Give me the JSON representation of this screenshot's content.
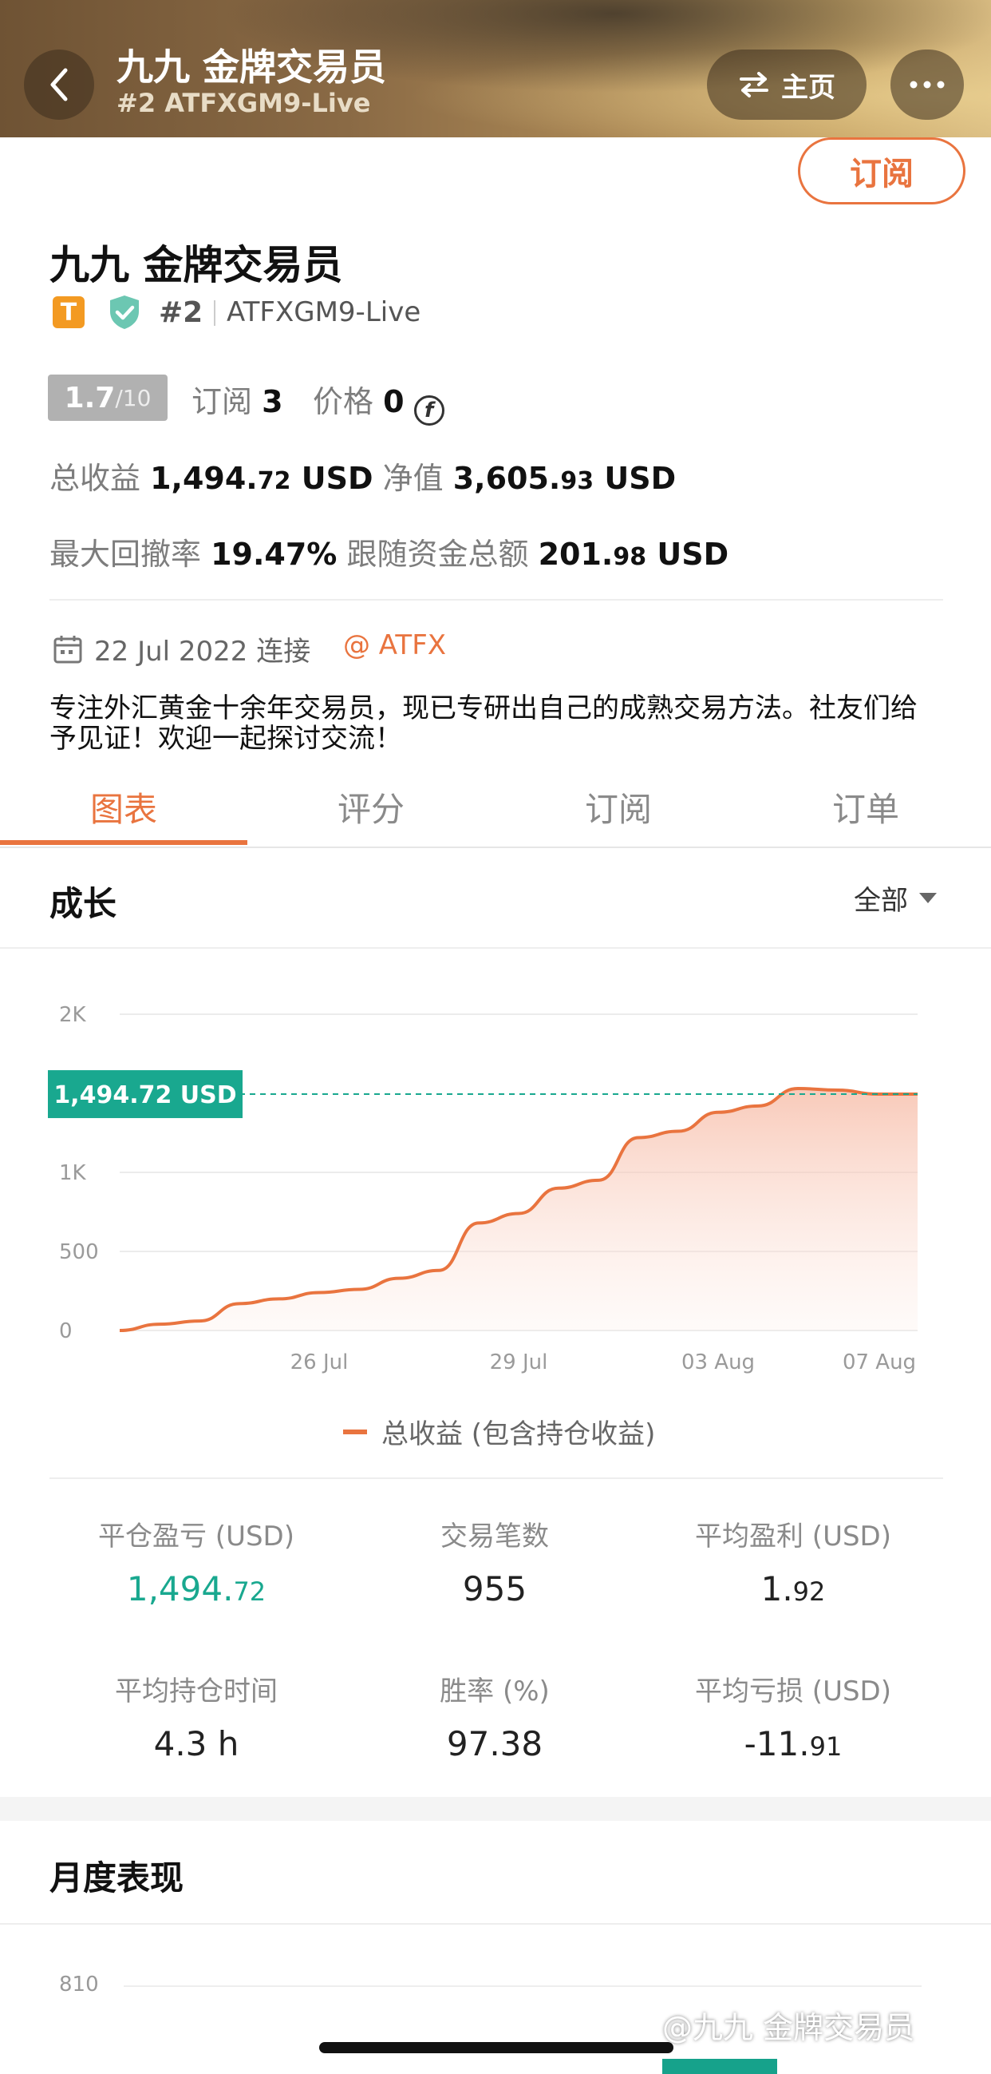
{
  "header": {
    "title": "九九 金牌交易员",
    "subtitle": "#2 ATFXGM9-Live",
    "home_label": "主页"
  },
  "subscribe_label": "订阅",
  "profile": {
    "name": "九九 金牌交易员",
    "badge": "T",
    "rank": "#2",
    "account": "ATFXGM9-Live",
    "score": "1.7",
    "score_max": "/10",
    "subscribe_text": "订阅",
    "subscribe_count": "3",
    "price_text": "价格",
    "price_value": "0",
    "price_icon": "coin-icon",
    "total_profit_label": "总收益",
    "total_profit_int": "1,494.",
    "total_profit_dec": "72",
    "equity_label": "净值",
    "equity_int": "3,605.",
    "equity_dec": "93",
    "currency": "USD",
    "drawdown_label": "最大回撤率",
    "drawdown_value": "19.47%",
    "follow_label": "跟随资金总额",
    "follow_int": "201.",
    "follow_dec": "98",
    "connected_date": "22 Jul 2022 连接",
    "broker": "@ ATFX",
    "description": "专注外汇黄金十余年交易员，现已专研出自己的成熟交易方法。社友们给予见证！欢迎一起探讨交流！"
  },
  "tabs": [
    "图表",
    "评分",
    "订阅",
    "订单"
  ],
  "growth": {
    "title": "成长",
    "filter": "全部",
    "legend": "总收益 (包含持仓收益)"
  },
  "chart_data": {
    "type": "area",
    "series": [
      {
        "values": [
          0,
          40,
          60,
          170,
          200,
          240,
          260,
          330,
          380,
          680,
          740,
          900,
          950,
          1220,
          1260,
          1380,
          1420,
          1530,
          1520,
          1494.72,
          1494.72
        ]
      }
    ],
    "x_tick_labels": [
      "26 Jul",
      "29 Jul",
      "03 Aug",
      "07 Aug"
    ],
    "y_ticks": [
      "0",
      "500",
      "1K",
      "2K"
    ],
    "ylim": [
      0,
      2000
    ],
    "current_label": "1,494.72 USD",
    "current_value": 1494.72,
    "color": "#e9743f",
    "marker_color": "#19a88f",
    "grid": true
  },
  "stats": [
    {
      "label": "平仓盈亏 (USD)",
      "int": "1,494.",
      "dec": "72",
      "color": "#19a88f"
    },
    {
      "label": "交易笔数",
      "int": "955",
      "dec": "",
      "color": "#222222"
    },
    {
      "label": "平均盈利 (USD)",
      "int": "1.",
      "dec": "92",
      "color": "#222222"
    },
    {
      "label": "平均持仓时间",
      "int": "4.3 h",
      "dec": "",
      "color": "#222222"
    },
    {
      "label": "胜率 (%)",
      "int": "97.38",
      "dec": "",
      "color": "#222222"
    },
    {
      "label": "平均亏损 (USD)",
      "int": "-11.",
      "dec": "91",
      "color": "#222222"
    }
  ],
  "monthly": {
    "title": "月度表现",
    "y_tick": "810"
  },
  "watermark": "@九九 金牌交易员"
}
